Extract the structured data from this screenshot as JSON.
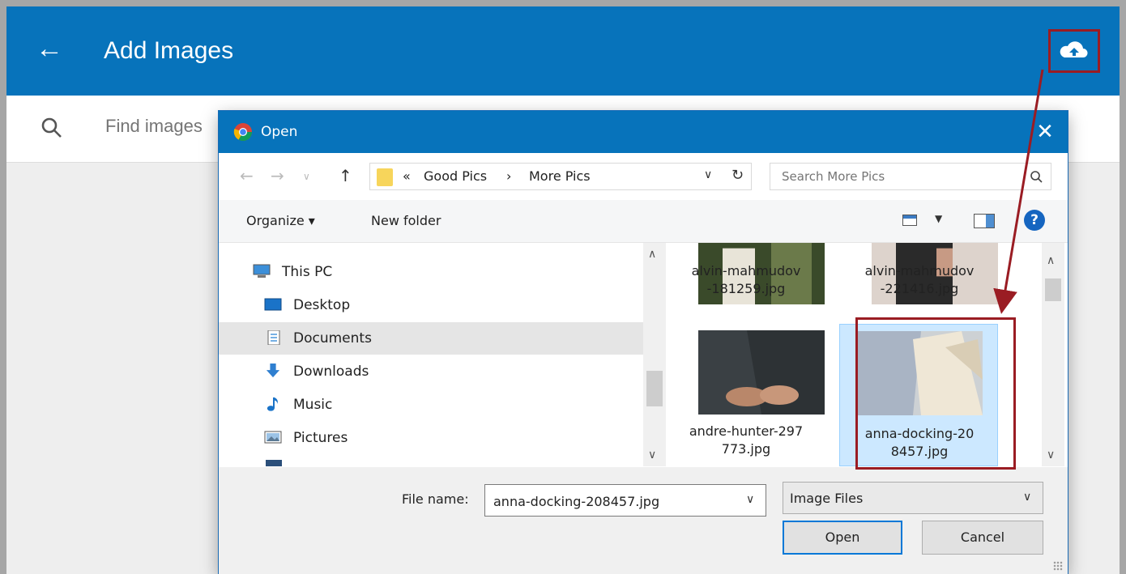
{
  "app": {
    "title": "Add Images",
    "search_placeholder": "Find images",
    "colors": {
      "primary": "#0773bb",
      "callout": "#9a1c23"
    }
  },
  "dialog": {
    "title": "Open",
    "address": {
      "crumb_prefix": "«",
      "crumbs": [
        "Good Pics",
        "More Pics"
      ]
    },
    "search_placeholder": "Search More Pics",
    "toolbar": {
      "organize_label": "Organize ▾",
      "new_folder_label": "New folder"
    },
    "nav_items": [
      {
        "label": "This PC",
        "icon": "pc-icon"
      },
      {
        "label": "Desktop",
        "icon": "desktop-icon"
      },
      {
        "label": "Documents",
        "icon": "documents-icon",
        "selected": true
      },
      {
        "label": "Downloads",
        "icon": "downloads-icon"
      },
      {
        "label": "Music",
        "icon": "music-icon"
      },
      {
        "label": "Pictures",
        "icon": "pictures-icon"
      }
    ],
    "files": [
      {
        "name_line1": "alvin-mahmudov",
        "name_line2": "-181259.jpg"
      },
      {
        "name_line1": "alvin-mahmudov",
        "name_line2": "-221416.jpg"
      },
      {
        "name_line1": "andre-hunter-297",
        "name_line2": "773.jpg"
      },
      {
        "name_line1": "anna-docking-20",
        "name_line2": "8457.jpg",
        "selected": true
      }
    ],
    "file_name_label": "File name:",
    "file_name_value": "anna-docking-208457.jpg",
    "file_type": "Image Files",
    "open_label": "Open",
    "cancel_label": "Cancel"
  }
}
